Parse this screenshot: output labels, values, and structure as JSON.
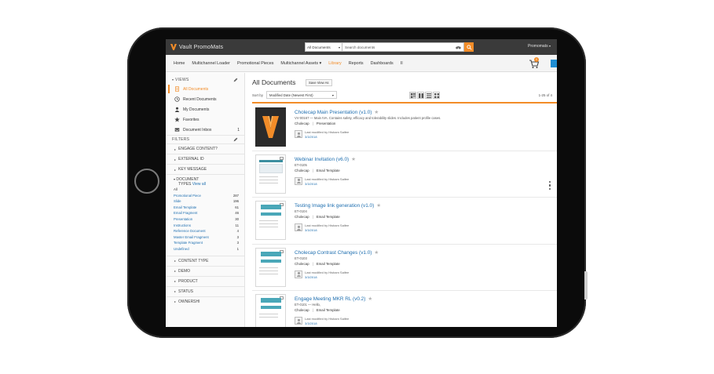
{
  "app": {
    "logo_text": "Vault PromoMats",
    "search_scope": "All Documents",
    "search_placeholder": "Search documents",
    "user_label": "Promomats"
  },
  "nav": {
    "items": [
      {
        "label": "Home",
        "active": false
      },
      {
        "label": "Multichannel Loader",
        "active": false
      },
      {
        "label": "Promotional Pieces",
        "active": false
      },
      {
        "label": "Multichannel Assets ▾",
        "active": false
      },
      {
        "label": "Library",
        "active": true
      },
      {
        "label": "Reports",
        "active": false
      },
      {
        "label": "Dashboards",
        "active": false
      },
      {
        "label": "II",
        "active": false
      }
    ],
    "cart_count": "0"
  },
  "sidebar": {
    "views_label": "VIEWS",
    "views": [
      {
        "label": "All Documents",
        "icon": "documents-icon",
        "active": true,
        "count": ""
      },
      {
        "label": "Recent Documents",
        "icon": "clock-icon",
        "active": false,
        "count": ""
      },
      {
        "label": "My Documents",
        "icon": "user-icon",
        "active": false,
        "count": ""
      },
      {
        "label": "Favorites",
        "icon": "star-icon",
        "active": false,
        "count": ""
      },
      {
        "label": "Document Inbox",
        "icon": "inbox-icon",
        "active": false,
        "count": "1"
      }
    ],
    "filters_label": "FILTERS",
    "filters_top": [
      "ENGAGE CONTENT?",
      "EXTERNAL ID",
      "KEY MESSAGE"
    ],
    "doctype_label_1": "DOCUMENT",
    "doctype_label_2": "TYPES",
    "doctype_view_all": "View all",
    "doctypes": [
      {
        "label": "All",
        "count": ""
      },
      {
        "label": "Promotional Piece",
        "count": "287"
      },
      {
        "label": "Slide",
        "count": "196"
      },
      {
        "label": "Email Template",
        "count": "61"
      },
      {
        "label": "Email Fragment",
        "count": "46"
      },
      {
        "label": "Presentation",
        "count": "30"
      },
      {
        "label": "Instructions",
        "count": "11"
      },
      {
        "label": "Reference Document",
        "count": "4"
      },
      {
        "label": "Master Email Fragment",
        "count": "3"
      },
      {
        "label": "Template Fragment",
        "count": "3"
      },
      {
        "label": "Undefined",
        "count": "1"
      }
    ],
    "filters_bottom": [
      "CONTENT TYPE",
      "DEMO",
      "PRODUCT",
      "STATUS",
      "OWNERSHI"
    ]
  },
  "main": {
    "title": "All Documents",
    "save_view": "Save View As",
    "sort_by_label": "Sort by",
    "sort_value": "Modified Date (Newest First)",
    "result_count": "1-25 of 4",
    "documents": [
      {
        "title": "Cholecap Main Presentation (v1.0)",
        "sub": "VV-00167 — Main IVA. Contains safety, efficacy and tolerability slides. Includes patient profile cases.",
        "product": "Cholecap",
        "type": "Presentation",
        "modified_by": "Last modified by Hisham Saifee",
        "date": "3/3/2018",
        "thumb": "veeva"
      },
      {
        "title": "Webinar Invitation (v6.0)",
        "sub": "ET-0105",
        "product": "Cholecap",
        "type": "Email Template",
        "modified_by": "Last modified by Hisham Saifee",
        "date": "3/3/2018",
        "thumb": "doc"
      },
      {
        "title": "Testing Image link generation (v1.0)",
        "sub": "ET-0104",
        "product": "Cholecap",
        "type": "Email Template",
        "modified_by": "Last modified by Hisham Saifee",
        "date": "3/3/2018",
        "thumb": "email"
      },
      {
        "title": "Cholecap Contrast Changes (v1.0)",
        "sub": "ET-0103",
        "product": "Cholecap",
        "type": "Email Template",
        "modified_by": "Last modified by Hisham Saifee",
        "date": "3/3/2018",
        "thumb": "email"
      },
      {
        "title": "Engage Meeting MKR RL (v0.2)",
        "sub": "ET-0101 — Hello,",
        "product": "Cholecap",
        "type": "Email Template",
        "modified_by": "Last modified by Hisham Saifee",
        "date": "3/3/2018",
        "thumb": "email"
      }
    ]
  },
  "colors": {
    "accent": "#f28c28",
    "link": "#1f6fb0",
    "topbar": "#3a3a3a"
  }
}
